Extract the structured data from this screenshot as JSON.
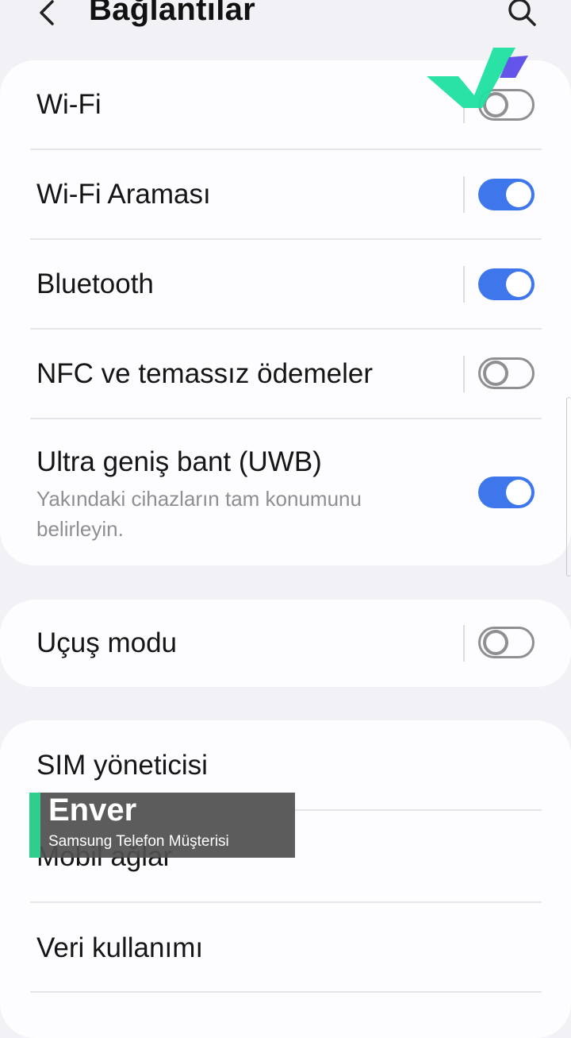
{
  "header": {
    "title": "Bağlantılar",
    "back_icon": "chevron-left-icon",
    "search_icon": "search-icon"
  },
  "settings_group_1": [
    {
      "label": "Wi-Fi",
      "toggle": false
    },
    {
      "label": "Wi-Fi Araması",
      "toggle": true
    },
    {
      "label": "Bluetooth",
      "toggle": true
    },
    {
      "label": "NFC ve temassız ödemeler",
      "toggle": false
    },
    {
      "label": "Ultra geniş bant (UWB)",
      "description": "Yakındaki cihazların tam konumunu belirleyin.",
      "toggle": true
    }
  ],
  "settings_group_2": [
    {
      "label": "Uçuş modu",
      "toggle": false
    }
  ],
  "settings_group_3": [
    {
      "label": "SIM yöneticisi"
    },
    {
      "label": "Mobil ağlar"
    },
    {
      "label": "Veri kullanımı"
    }
  ],
  "overlay": {
    "name": "Enver",
    "role": "Samsung Telefon Müşterisi"
  },
  "colors": {
    "accent": "#3e76ec",
    "background": "#f2f1f6",
    "card": "#fdfcff",
    "overlay_accent": "#2ecf8d",
    "logo_green": "#1fe0a0",
    "logo_purple": "#5b4ce8"
  }
}
